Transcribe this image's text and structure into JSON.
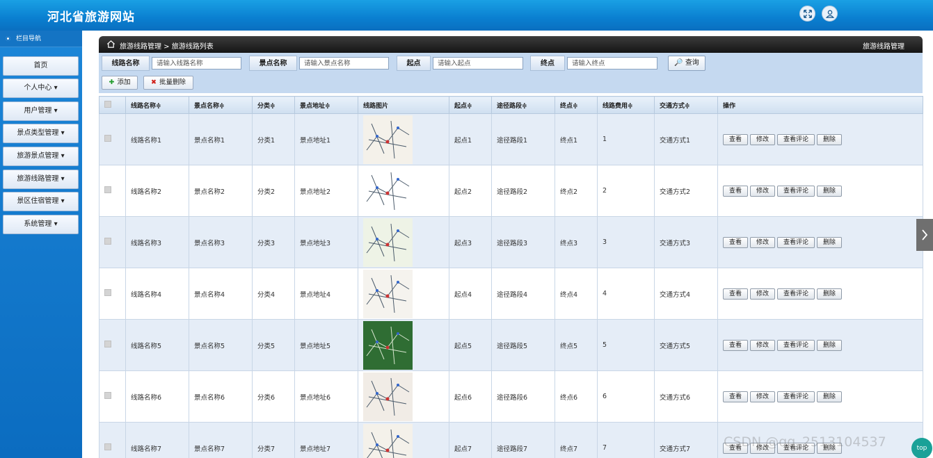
{
  "header": {
    "title": "河北省旅游网站",
    "icons": [
      "fullscreen-icon",
      "user-icon"
    ]
  },
  "sidebar": {
    "title": "栏目导航",
    "items": [
      {
        "label": "首页"
      },
      {
        "label": "个人中心 ▾"
      },
      {
        "label": "用户管理 ▾"
      },
      {
        "label": "景点类型管理 ▾"
      },
      {
        "label": "旅游景点管理 ▾"
      },
      {
        "label": "旅游线路管理 ▾"
      },
      {
        "label": "景区住宿管理 ▾"
      },
      {
        "label": "系统管理 ▾"
      }
    ]
  },
  "breadcrumb": {
    "text": "旅游线路管理 > 旅游线路列表",
    "right": "旅游线路管理"
  },
  "search": {
    "route_label": "线路名称",
    "route_placeholder": "请输入线路名称",
    "spot_label": "景点名称",
    "spot_placeholder": "请输入景点名称",
    "start_label": "起点",
    "start_placeholder": "请输入起点",
    "end_label": "终点",
    "end_placeholder": "请输入终点",
    "query_label": "查询"
  },
  "toolbar": {
    "add_label": "添加",
    "batch_delete_label": "批量删除"
  },
  "table": {
    "headers": [
      "线路名称≑",
      "景点名称≑",
      "分类≑",
      "景点地址≑",
      "线路图片",
      "起点≑",
      "途径路段≑",
      "终点≑",
      "线路费用≑",
      "交通方式≑",
      "操作"
    ],
    "actions": [
      "查看",
      "修改",
      "查看评论",
      "删除"
    ],
    "rows": [
      {
        "route": "线路名称1",
        "spot": "景点名称1",
        "category": "分类1",
        "address": "景点地址1",
        "start": "起点1",
        "via": "途径路段1",
        "end": "终点1",
        "cost": "1",
        "transport": "交通方式1"
      },
      {
        "route": "线路名称2",
        "spot": "景点名称2",
        "category": "分类2",
        "address": "景点地址2",
        "start": "起点2",
        "via": "途径路段2",
        "end": "终点2",
        "cost": "2",
        "transport": "交通方式2"
      },
      {
        "route": "线路名称3",
        "spot": "景点名称3",
        "category": "分类3",
        "address": "景点地址3",
        "start": "起点3",
        "via": "途径路段3",
        "end": "终点3",
        "cost": "3",
        "transport": "交通方式3"
      },
      {
        "route": "线路名称4",
        "spot": "景点名称4",
        "category": "分类4",
        "address": "景点地址4",
        "start": "起点4",
        "via": "途径路段4",
        "end": "终点4",
        "cost": "4",
        "transport": "交通方式4"
      },
      {
        "route": "线路名称5",
        "spot": "景点名称5",
        "category": "分类5",
        "address": "景点地址5",
        "start": "起点5",
        "via": "途径路段5",
        "end": "终点5",
        "cost": "5",
        "transport": "交通方式5"
      },
      {
        "route": "线路名称6",
        "spot": "景点名称6",
        "category": "分类6",
        "address": "景点地址6",
        "start": "起点6",
        "via": "途径路段6",
        "end": "终点6",
        "cost": "6",
        "transport": "交通方式6"
      },
      {
        "route": "线路名称7",
        "spot": "景点名称7",
        "category": "分类7",
        "address": "景点地址7",
        "start": "起点7",
        "via": "途径路段7",
        "end": "终点7",
        "cost": "7",
        "transport": "交通方式7"
      }
    ]
  },
  "overlay": {
    "watermark": "CSDN @qq_2513104537",
    "top_badge": "top"
  },
  "colors": {
    "header_blue": "#0a7fd0",
    "sidebar_blue": "#1474c4",
    "search_bg": "#c5d9f0",
    "row_alt": "#e5edf7"
  }
}
